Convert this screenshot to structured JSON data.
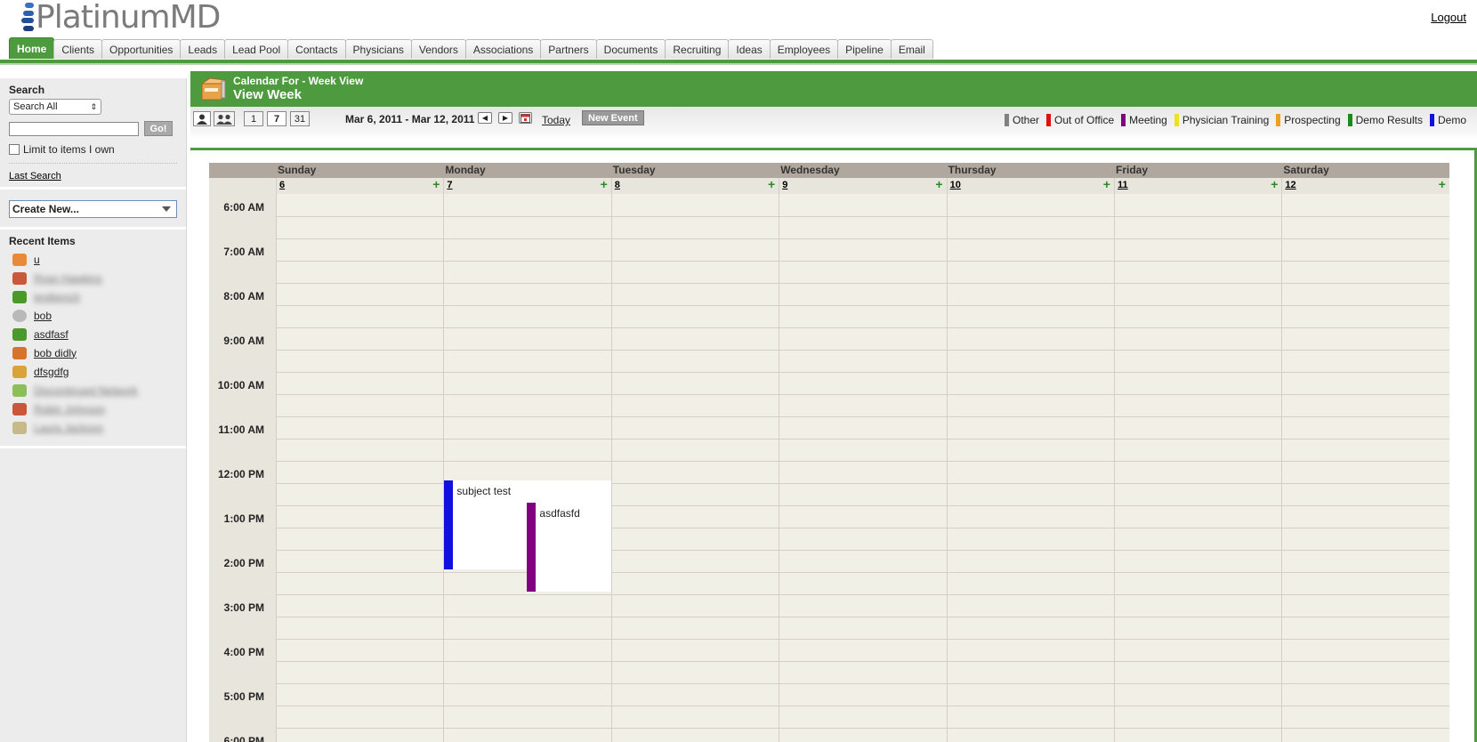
{
  "header": {
    "logo_text": "PlatinumMD",
    "logout_label": "Logout"
  },
  "tabs": [
    "Home",
    "Clients",
    "Opportunities",
    "Leads",
    "Lead Pool",
    "Contacts",
    "Physicians",
    "Vendors",
    "Associations",
    "Partners",
    "Documents",
    "Recruiting",
    "Ideas",
    "Employees",
    "Pipeline",
    "Email"
  ],
  "active_tab": "Home",
  "sidebar": {
    "search_title": "Search",
    "search_select_value": "Search All",
    "search_input_value": "",
    "go_label": "Go!",
    "limit_label": "Limit to items I own",
    "last_search_label": "Last Search",
    "create_new_label": "Create New...",
    "recent_title": "Recent Items",
    "recent_items": [
      {
        "label": "u",
        "icon": "house-icon",
        "blurred": false
      },
      {
        "label": "Ryan Hawkins",
        "icon": "building-icon",
        "blurred": true
      },
      {
        "label": "testbench",
        "icon": "pin-icon",
        "blurred": true
      },
      {
        "label": "bob",
        "icon": "contact-icon",
        "blurred": false
      },
      {
        "label": "asdfasf",
        "icon": "pin-icon",
        "blurred": false
      },
      {
        "label": "bob didly",
        "icon": "people-icon",
        "blurred": false
      },
      {
        "label": "dfsgdfg",
        "icon": "handshake-icon",
        "blurred": false
      },
      {
        "label": "Discontinued Network",
        "icon": "money-icon",
        "blurred": true
      },
      {
        "label": "Robin Johnson",
        "icon": "building-icon",
        "blurred": true
      },
      {
        "label": "Laura Jackson",
        "icon": "document-icon",
        "blurred": true
      }
    ]
  },
  "calendar": {
    "subtitle": "Calendar For - Week View",
    "title": "View Week",
    "view_buttons": [
      "1",
      "7",
      "31"
    ],
    "selected_view": "7",
    "date_range": "Mar 6, 2011 - Mar 12, 2011",
    "today_label": "Today",
    "new_event_label": "New Event",
    "legend": [
      {
        "label": "Other",
        "color": "#808080"
      },
      {
        "label": "Out of Office",
        "color": "#e01010"
      },
      {
        "label": "Meeting",
        "color": "#800080"
      },
      {
        "label": "Physician Training",
        "color": "#f0e020"
      },
      {
        "label": "Prospecting",
        "color": "#f0a020"
      },
      {
        "label": "Demo Results",
        "color": "#1a8a1a"
      },
      {
        "label": "Demo",
        "color": "#1010e0"
      }
    ],
    "days": [
      {
        "name": "Sunday",
        "date": "6"
      },
      {
        "name": "Monday",
        "date": "7"
      },
      {
        "name": "Tuesday",
        "date": "8"
      },
      {
        "name": "Wednesday",
        "date": "9"
      },
      {
        "name": "Thursday",
        "date": "10"
      },
      {
        "name": "Friday",
        "date": "11"
      },
      {
        "name": "Saturday",
        "date": "12"
      }
    ],
    "times": [
      "6:00 AM",
      "7:00 AM",
      "8:00 AM",
      "9:00 AM",
      "10:00 AM",
      "11:00 AM",
      "12:00 PM",
      "1:00 PM",
      "2:00 PM",
      "3:00 PM",
      "4:00 PM",
      "5:00 PM",
      "6:00 PM"
    ],
    "events": [
      {
        "title": "subject test",
        "day": "Monday",
        "start": "12:30 PM",
        "end": "2:30 PM",
        "color": "#1010e0"
      },
      {
        "title": "asdfasfd",
        "day": "Monday",
        "start": "1:00 PM",
        "end": "3:00 PM",
        "color": "#800080"
      }
    ]
  }
}
